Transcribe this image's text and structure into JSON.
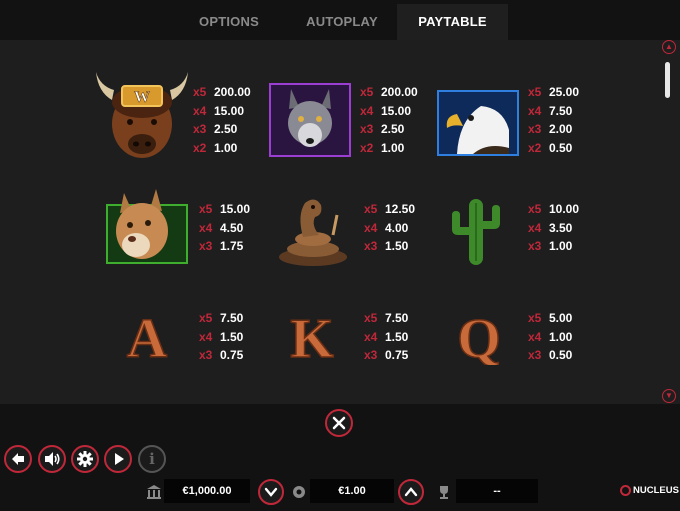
{
  "tabs": [
    {
      "label": "OPTIONS"
    },
    {
      "label": "AUTOPLAY"
    },
    {
      "label": "PAYTABLE",
      "active": true
    }
  ],
  "paytable": [
    {
      "symbol": "buffalo-wild",
      "icon_letter": "W",
      "pays": [
        {
          "m": "x5",
          "v": "200.00"
        },
        {
          "m": "x4",
          "v": "15.00"
        },
        {
          "m": "x3",
          "v": "2.50"
        },
        {
          "m": "x2",
          "v": "1.00"
        }
      ]
    },
    {
      "symbol": "wolf",
      "pays": [
        {
          "m": "x5",
          "v": "200.00"
        },
        {
          "m": "x4",
          "v": "15.00"
        },
        {
          "m": "x3",
          "v": "2.50"
        },
        {
          "m": "x2",
          "v": "1.00"
        }
      ]
    },
    {
      "symbol": "eagle",
      "pays": [
        {
          "m": "x5",
          "v": "25.00"
        },
        {
          "m": "x4",
          "v": "7.50"
        },
        {
          "m": "x3",
          "v": "2.00"
        },
        {
          "m": "x2",
          "v": "0.50"
        }
      ]
    },
    {
      "symbol": "cougar",
      "pays": [
        {
          "m": "x5",
          "v": "15.00"
        },
        {
          "m": "x4",
          "v": "4.50"
        },
        {
          "m": "x3",
          "v": "1.75"
        }
      ]
    },
    {
      "symbol": "snake",
      "pays": [
        {
          "m": "x5",
          "v": "12.50"
        },
        {
          "m": "x4",
          "v": "4.00"
        },
        {
          "m": "x3",
          "v": "1.50"
        }
      ]
    },
    {
      "symbol": "cactus",
      "pays": [
        {
          "m": "x5",
          "v": "10.00"
        },
        {
          "m": "x4",
          "v": "3.50"
        },
        {
          "m": "x3",
          "v": "1.00"
        }
      ]
    },
    {
      "symbol": "A",
      "pays": [
        {
          "m": "x5",
          "v": "7.50"
        },
        {
          "m": "x4",
          "v": "1.50"
        },
        {
          "m": "x3",
          "v": "0.75"
        }
      ]
    },
    {
      "symbol": "K",
      "pays": [
        {
          "m": "x5",
          "v": "7.50"
        },
        {
          "m": "x4",
          "v": "1.50"
        },
        {
          "m": "x3",
          "v": "0.75"
        }
      ]
    },
    {
      "symbol": "Q",
      "pays": [
        {
          "m": "x5",
          "v": "5.00"
        },
        {
          "m": "x4",
          "v": "1.00"
        },
        {
          "m": "x3",
          "v": "0.50"
        }
      ]
    }
  ],
  "footer": {
    "balance": "€1,000.00",
    "bet": "€1.00",
    "win": "--",
    "brand": "NUCLEUS"
  },
  "colors": {
    "accent": "#c0283a",
    "panel": "#1e1e1e",
    "background": "#0d0d0d"
  },
  "icons": [
    "back-icon",
    "sound-icon",
    "settings-icon",
    "play-icon",
    "info-icon",
    "close-icon",
    "chevron-up-icon",
    "chevron-down-icon",
    "bank-icon",
    "coins-icon",
    "trophy-icon"
  ]
}
